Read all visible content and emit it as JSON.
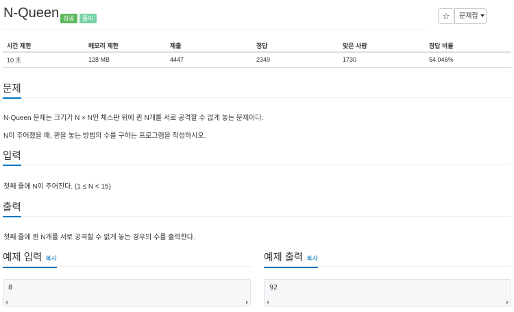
{
  "problem": {
    "title": "N-Queen",
    "badges": {
      "success": "성공",
      "solve": "풀이"
    }
  },
  "toolbar": {
    "star_icon": "☆",
    "problem_set_label": "문제집"
  },
  "info_table": {
    "headers": [
      "시간 제한",
      "메모리 제한",
      "제출",
      "정답",
      "맞은 사람",
      "정답 비율"
    ],
    "row": [
      "10 초",
      "128 MB",
      "4447",
      "2349",
      "1730",
      "54.046%"
    ]
  },
  "sections": {
    "problem": {
      "heading": "문제",
      "lines": [
        "N-Queen 문제는 크기가 N × N인 체스판 위에 퀸 N개를 서로 공격할 수 없게 놓는 문제이다.",
        "N이 주어졌을 때, 퀸을 놓는 방법의 수를 구하는 프로그램을 작성하시오."
      ]
    },
    "input": {
      "heading": "입력",
      "text": "첫째 줄에 N이 주어진다. (1 ≤ N < 15)"
    },
    "output": {
      "heading": "출력",
      "text": "첫째 줄에 퀸 N개를 서로 공격할 수 없게 놓는 경우의 수를 출력한다."
    },
    "sample_input": {
      "heading": "예제 입력",
      "copy_label": "복사",
      "value": "8"
    },
    "sample_output": {
      "heading": "예제 출력",
      "copy_label": "복사",
      "value": "92"
    }
  },
  "colors": {
    "success_badge": "#5cb85c",
    "solve_badge": "#77d2a8",
    "accent": "#0076c0"
  }
}
